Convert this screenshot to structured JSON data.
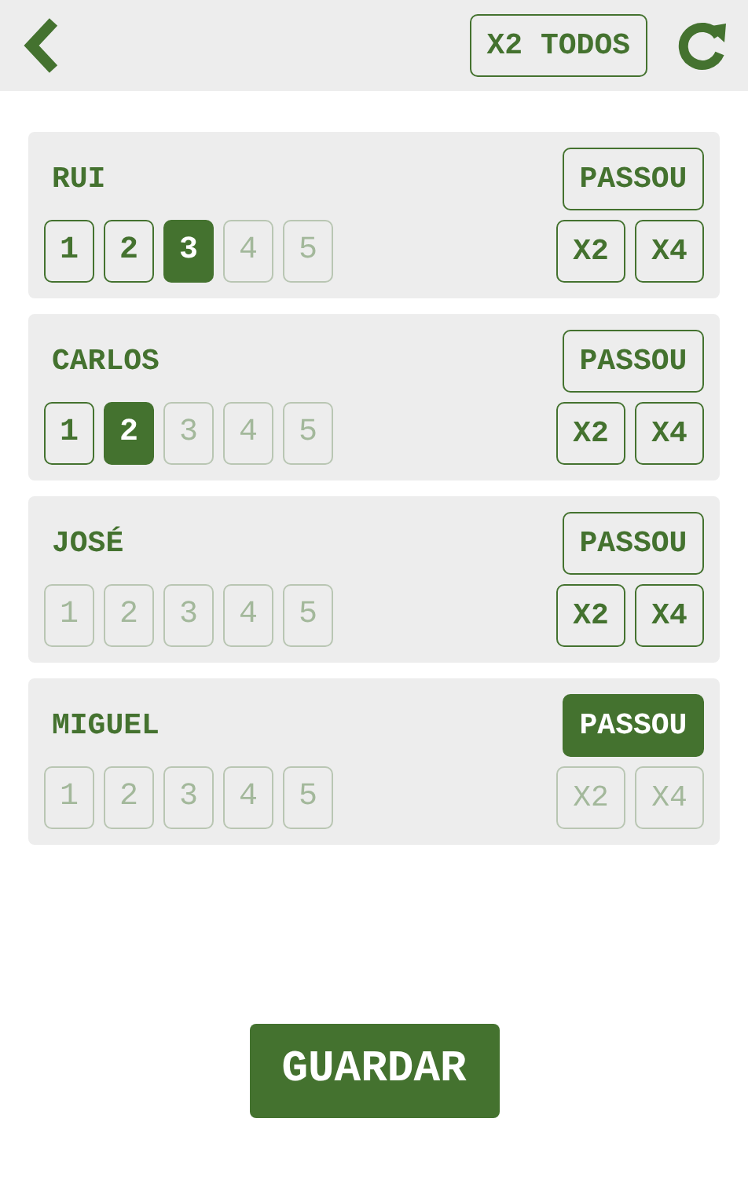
{
  "header": {
    "all_double_button": "X2 TODOS"
  },
  "players": [
    {
      "name": "RUI",
      "scores": [
        {
          "label": "1",
          "selected": false,
          "disabled": false
        },
        {
          "label": "2",
          "selected": false,
          "disabled": false
        },
        {
          "label": "3",
          "selected": true,
          "disabled": false
        },
        {
          "label": "4",
          "selected": false,
          "disabled": true
        },
        {
          "label": "5",
          "selected": false,
          "disabled": true
        }
      ],
      "pass": {
        "label": "PASSOU",
        "selected": false
      },
      "multipliers": [
        {
          "label": "X2",
          "disabled": false
        },
        {
          "label": "X4",
          "disabled": false
        }
      ]
    },
    {
      "name": "CARLOS",
      "scores": [
        {
          "label": "1",
          "selected": false,
          "disabled": false
        },
        {
          "label": "2",
          "selected": true,
          "disabled": false
        },
        {
          "label": "3",
          "selected": false,
          "disabled": true
        },
        {
          "label": "4",
          "selected": false,
          "disabled": true
        },
        {
          "label": "5",
          "selected": false,
          "disabled": true
        }
      ],
      "pass": {
        "label": "PASSOU",
        "selected": false
      },
      "multipliers": [
        {
          "label": "X2",
          "disabled": false
        },
        {
          "label": "X4",
          "disabled": false
        }
      ]
    },
    {
      "name": "JOSÉ",
      "scores": [
        {
          "label": "1",
          "selected": false,
          "disabled": true
        },
        {
          "label": "2",
          "selected": false,
          "disabled": true
        },
        {
          "label": "3",
          "selected": false,
          "disabled": true
        },
        {
          "label": "4",
          "selected": false,
          "disabled": true
        },
        {
          "label": "5",
          "selected": false,
          "disabled": true
        }
      ],
      "pass": {
        "label": "PASSOU",
        "selected": false
      },
      "multipliers": [
        {
          "label": "X2",
          "disabled": false
        },
        {
          "label": "X4",
          "disabled": false
        }
      ]
    },
    {
      "name": "MIGUEL",
      "scores": [
        {
          "label": "1",
          "selected": false,
          "disabled": true
        },
        {
          "label": "2",
          "selected": false,
          "disabled": true
        },
        {
          "label": "3",
          "selected": false,
          "disabled": true
        },
        {
          "label": "4",
          "selected": false,
          "disabled": true
        },
        {
          "label": "5",
          "selected": false,
          "disabled": true
        }
      ],
      "pass": {
        "label": "PASSOU",
        "selected": true
      },
      "multipliers": [
        {
          "label": "X2",
          "disabled": true
        },
        {
          "label": "X4",
          "disabled": true
        }
      ]
    }
  ],
  "save_button": "GUARDAR"
}
